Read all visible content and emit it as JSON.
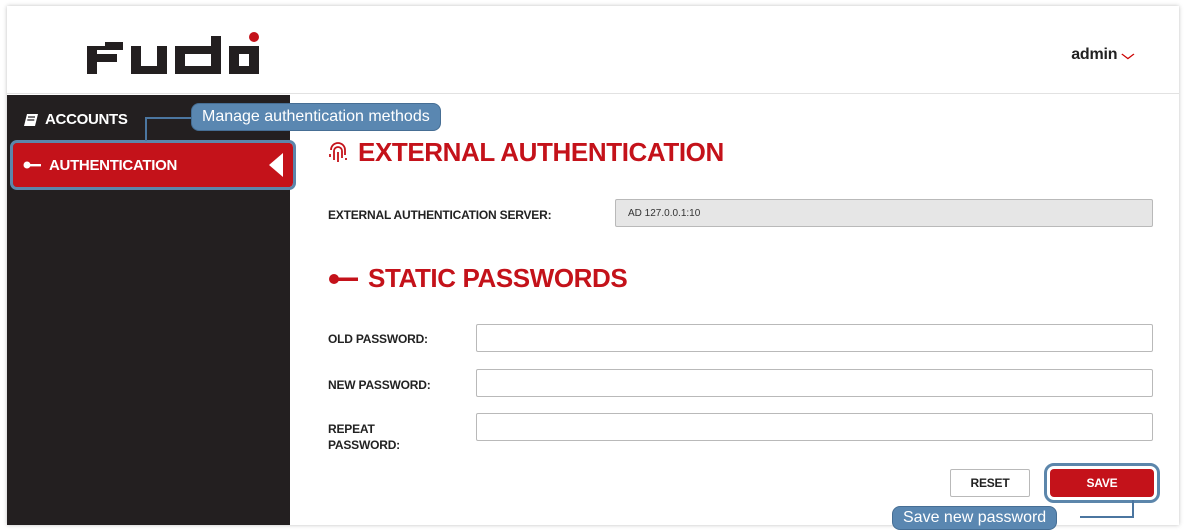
{
  "header": {
    "logo_text": "FUDO",
    "user_label": "admin",
    "user_chevron_icon": "chevron-down-icon"
  },
  "sidebar": {
    "items": [
      {
        "label": "ACCOUNTS",
        "icon": "book-icon"
      },
      {
        "label": "AUTHENTICATION",
        "icon": "key-icon",
        "active": true
      }
    ]
  },
  "main": {
    "external": {
      "title": "EXTERNAL AUTHENTICATION",
      "icon": "fingerprint-icon",
      "server_label": "EXTERNAL AUTHENTICATION SERVER:",
      "server_value": "AD 127.0.0.1:10"
    },
    "static": {
      "title": "STATIC PASSWORDS",
      "icon": "key-icon",
      "old_label": "OLD PASSWORD:",
      "new_label": "NEW PASSWORD:",
      "repeat_label_line1": "REPEAT",
      "repeat_label_line2": "PASSWORD:",
      "reset_label": "RESET",
      "save_label": "SAVE"
    }
  },
  "callouts": {
    "auth": "Manage authentication methods",
    "save": "Save new password"
  },
  "colors": {
    "brand_red": "#c4121a",
    "sidebar_bg": "#231f20",
    "callout_blue": "#5a87b1"
  }
}
